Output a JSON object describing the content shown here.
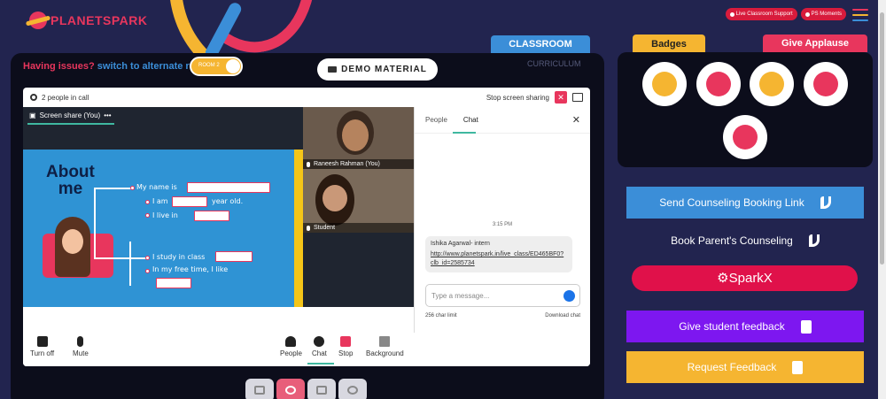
{
  "header": {
    "logo_text": "PLANETSPARK",
    "live_support": "Live Classroom Support",
    "ps_moments": "PS Moments",
    "hamburger_colors": [
      "#e8365d",
      "#f5b531",
      "#3b8ed8"
    ]
  },
  "tabs": {
    "classroom": "CLASSROOM",
    "curriculum": "CURRICULUM"
  },
  "toolbar": {
    "issues_text": "Having issues?",
    "switch_text": "switch to alternate room",
    "room_label": "ROOM 2",
    "demo_material": "DEMO MATERIAL"
  },
  "meet": {
    "people_count": "2 people in call",
    "stop_sharing": "Stop screen sharing",
    "screen_share_label": "Screen share (You)",
    "slide": {
      "title_line1": "About",
      "title_line2": "me",
      "line1": "My name is",
      "line2a": "I am",
      "line2b": "year old.",
      "line3": "I live in",
      "line4": "I study in class",
      "line5": "In my free time, I like"
    },
    "participants": [
      {
        "name": "Raneesh Rahman (You)"
      },
      {
        "name": "Student"
      }
    ],
    "chat": {
      "tab_people": "People",
      "tab_chat": "Chat",
      "time": "3:15 PM",
      "sender": "Ishika Agarwal- intern",
      "link": "http://www.planetspark.in/live_class/ED465BF0?clb_id=2585734",
      "input_placeholder": "Type a message...",
      "char_limit": "256 char limit",
      "download": "Download chat"
    },
    "controls": {
      "turn_off": "Turn off",
      "mute": "Mute",
      "people": "People",
      "chat": "Chat",
      "stop": "Stop",
      "background": "Background"
    }
  },
  "right_panel": {
    "badges_tab": "Badges",
    "applause_tab": "Give Applause",
    "badge_colors": [
      "#f5b531",
      "#e8365d",
      "#f5b531",
      "#e8365d",
      "#e8365d"
    ],
    "send_counseling": "Send Counseling Booking Link",
    "book_counseling": "Book Parent's Counseling",
    "sparkx": "SparkX",
    "student_feedback": "Give student feedback",
    "request_feedback": "Request Feedback"
  }
}
